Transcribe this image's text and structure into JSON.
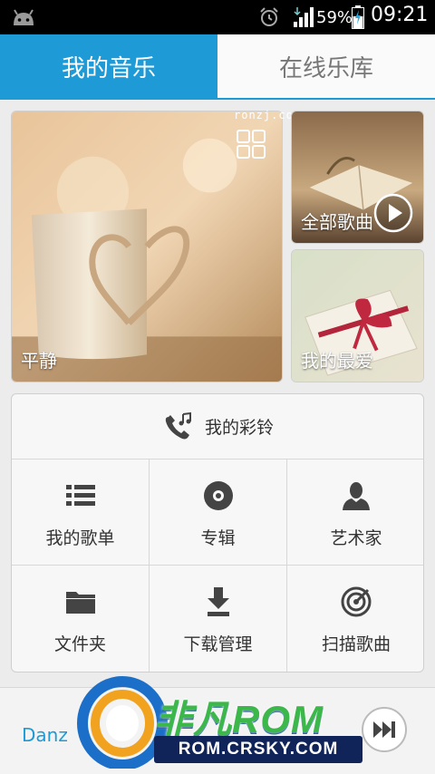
{
  "status_bar": {
    "battery_percent": "59%",
    "time": "09:21",
    "icons": [
      "android-icon",
      "alarm-icon",
      "signal-icon",
      "battery-charging-icon"
    ]
  },
  "tabs": {
    "my_music": "我的音乐",
    "online_library": "在线乐库",
    "active": "my_music"
  },
  "tiles": {
    "calm": "平静",
    "all_songs": "全部歌曲",
    "favorites": "我的最爱"
  },
  "watermark_top": "ronzj.com",
  "menu": {
    "ringtone": "我的彩铃",
    "playlists": "我的歌单",
    "albums": "专辑",
    "artists": "艺术家",
    "folders": "文件夹",
    "downloads": "下载管理",
    "scan": "扫描歌曲"
  },
  "now_playing": {
    "title": "Danz"
  },
  "logo": {
    "brand": "非凡ROM",
    "site": "ROM.CRSKY.COM"
  },
  "colors": {
    "accent": "#1e9ad6",
    "status_bar": "#000000",
    "background": "#ececec"
  }
}
